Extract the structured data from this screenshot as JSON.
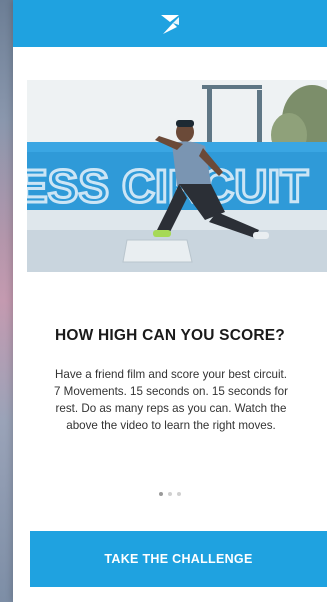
{
  "header": {
    "logo_icon": "brand-logo-icon",
    "accent_color": "#1fa2e0"
  },
  "hero": {
    "image": "athlete-lunge-photo"
  },
  "content": {
    "title": "HOW HIGH CAN YOU SCORE?",
    "description": "Have a friend film and score your best circuit. 7 Movements. 15 seconds on. 15 seconds for rest. Do as many reps as you can. Watch the above the video to learn the right moves."
  },
  "pagination": {
    "total": 3,
    "active_index": 1
  },
  "cta": {
    "label": "TAKE THE CHALLENGE"
  }
}
